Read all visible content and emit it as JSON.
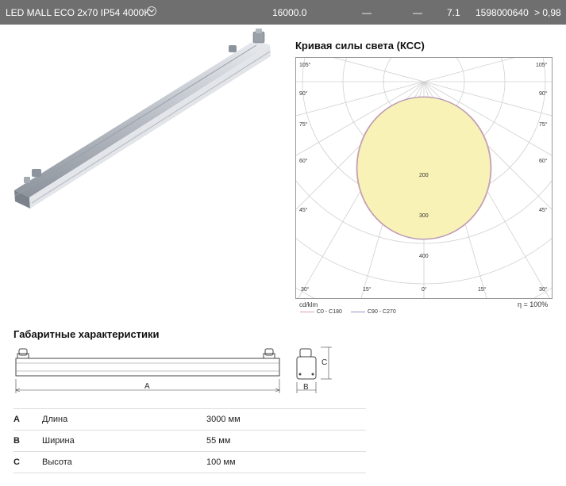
{
  "header": {
    "product_name": "LED MALL ECO 2x70 IP54 4000K",
    "flux": "16000.0",
    "col3": "—",
    "col4": "—",
    "weight": "7.1",
    "article": "1598000640",
    "power_factor": "> 0,98",
    "expand_icon": "chevron-down-icon"
  },
  "ksc": {
    "title": "Кривая силы света (КСС)",
    "angles_right": [
      "105°",
      "90°",
      "75°",
      "60°",
      "45°"
    ],
    "angles_left": [
      "105°",
      "90°",
      "75°",
      "60°",
      "45°"
    ],
    "angles_bottom": [
      "30°",
      "15°",
      "0°",
      "15°",
      "30°"
    ],
    "radial_labels": [
      "200",
      "300",
      "400"
    ],
    "unit": "cd/klm",
    "efficiency": "η = 100%",
    "legend": [
      {
        "label": "C0 - C180",
        "color": "#d9a0a8"
      },
      {
        "label": "C90 - C270",
        "color": "#9a8fc8"
      }
    ]
  },
  "dims": {
    "title": "Габаритные характеристики",
    "label_a": "A",
    "label_b": "B",
    "label_c": "C",
    "rows": [
      {
        "key": "A",
        "name": "Длина",
        "value": "3000 мм"
      },
      {
        "key": "B",
        "name": "Ширина",
        "value": "55 мм"
      },
      {
        "key": "C",
        "name": "Высота",
        "value": "100 мм"
      }
    ]
  }
}
